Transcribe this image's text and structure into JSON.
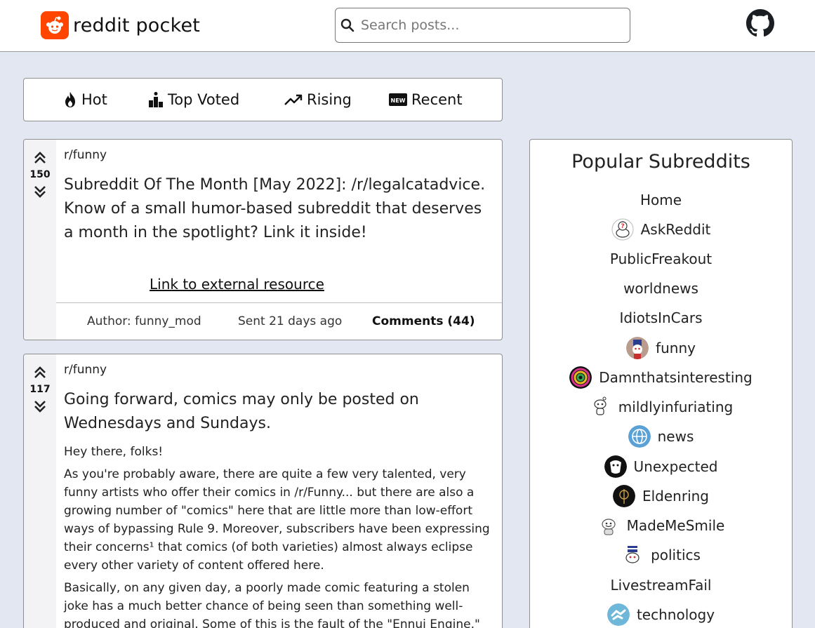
{
  "header": {
    "brand": "reddit pocket",
    "search_placeholder": "Search posts..."
  },
  "tabs": [
    {
      "label": "Hot",
      "icon": "flame-icon"
    },
    {
      "label": "Top Voted",
      "icon": "podium-icon"
    },
    {
      "label": "Rising",
      "icon": "trending-up-icon"
    },
    {
      "label": "Recent",
      "icon": "new-badge-icon"
    }
  ],
  "posts": [
    {
      "votes": "150",
      "subreddit": "r/funny",
      "title": "Subreddit Of The Month [May 2022]: /r/legalcatadvice. Know of a small humor-based subreddit that deserves a month in the spotlight? Link it inside!",
      "link_text": "Link to external resource",
      "author": "Author: funny_mod",
      "sent": "Sent 21 days ago",
      "comments": "Comments (44)"
    },
    {
      "votes": "117",
      "subreddit": "r/funny",
      "title": "Going forward, comics may only be posted on Wednesdays and Sundays.",
      "paragraphs": [
        "Hey there, folks!",
        "As you're probably aware, there are quite a few very talented, very funny artists who offer their comics in /r/Funny... but there are also a growing number of \"comics\" here that are little more than low-effort ways of bypassing Rule 9. Moreover, subscribers have been expressing their concerns¹ that comics (of both varieties) almost always eclipse every other variety of content offered here.",
        "Basically, on any given day, a poorly made comic featuring a stolen joke has a much better chance of being seen than something well-produced and original. Some of this is the fault of the \"Ennui Engine,\""
      ]
    }
  ],
  "sidebar": {
    "title": "Popular Subreddits",
    "items": [
      {
        "label": "Home",
        "icon": ""
      },
      {
        "label": "AskReddit",
        "icon": "askreddit-icon"
      },
      {
        "label": "PublicFreakout",
        "icon": ""
      },
      {
        "label": "worldnews",
        "icon": ""
      },
      {
        "label": "IdiotsInCars",
        "icon": ""
      },
      {
        "label": "funny",
        "icon": "funny-icon"
      },
      {
        "label": "Damnthatsinteresting",
        "icon": "damnthatsinteresting-icon"
      },
      {
        "label": "mildlyinfuriating",
        "icon": "mildlyinfuriating-icon"
      },
      {
        "label": "news",
        "icon": "news-globe-icon"
      },
      {
        "label": "Unexpected",
        "icon": "unexpected-icon"
      },
      {
        "label": "Eldenring",
        "icon": "eldenring-icon"
      },
      {
        "label": "MadeMeSmile",
        "icon": "mademesmile-icon"
      },
      {
        "label": "politics",
        "icon": "politics-icon"
      },
      {
        "label": "LivestreamFail",
        "icon": ""
      },
      {
        "label": "technology",
        "icon": "technology-icon"
      }
    ]
  },
  "colors": {
    "page_background": "#e3e7f1",
    "brand_orange": "#ff4500"
  }
}
